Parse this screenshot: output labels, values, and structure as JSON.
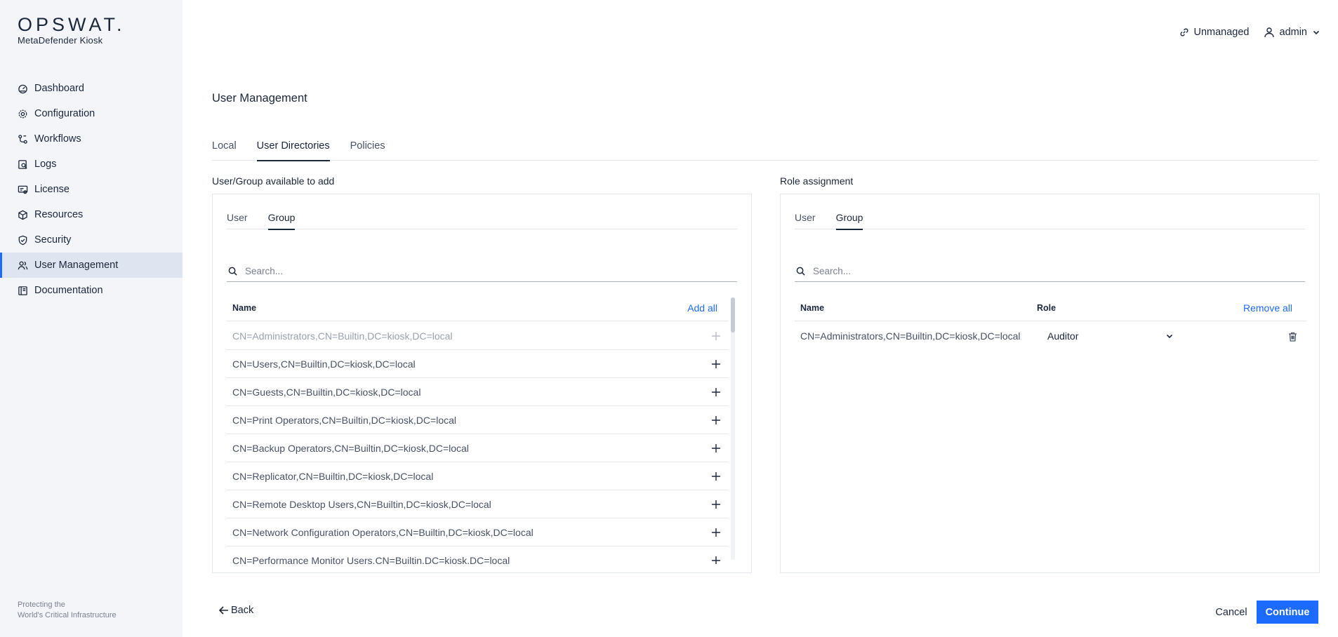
{
  "brand": {
    "logo": "OPSWAT.",
    "product": "MetaDefender Kiosk",
    "footer_line1": "Protecting the",
    "footer_line2": "World's Critical Infrastructure"
  },
  "sidebar": {
    "items": [
      {
        "label": "Dashboard",
        "icon": "dashboard-icon"
      },
      {
        "label": "Configuration",
        "icon": "gear-icon"
      },
      {
        "label": "Workflows",
        "icon": "workflow-icon"
      },
      {
        "label": "Logs",
        "icon": "logs-icon"
      },
      {
        "label": "License",
        "icon": "license-icon"
      },
      {
        "label": "Resources",
        "icon": "cube-icon"
      },
      {
        "label": "Security",
        "icon": "shield-icon"
      },
      {
        "label": "User Management",
        "icon": "users-icon",
        "active": true
      },
      {
        "label": "Documentation",
        "icon": "book-icon"
      }
    ]
  },
  "topbar": {
    "unmanaged": "Unmanaged",
    "user": "admin"
  },
  "page": {
    "title": "User Management",
    "tabs": [
      "Local",
      "User Directories",
      "Policies"
    ],
    "active_tab": "User Directories"
  },
  "available": {
    "label": "User/Group available to add",
    "tabs": [
      "User",
      "Group"
    ],
    "active_tab": "Group",
    "search_placeholder": "Search...",
    "col_name": "Name",
    "add_all": "Add all",
    "rows": [
      {
        "name": "CN=Administrators,CN=Builtin,DC=kiosk,DC=local",
        "disabled": true
      },
      {
        "name": "CN=Users,CN=Builtin,DC=kiosk,DC=local"
      },
      {
        "name": "CN=Guests,CN=Builtin,DC=kiosk,DC=local"
      },
      {
        "name": "CN=Print Operators,CN=Builtin,DC=kiosk,DC=local"
      },
      {
        "name": "CN=Backup Operators,CN=Builtin,DC=kiosk,DC=local"
      },
      {
        "name": "CN=Replicator,CN=Builtin,DC=kiosk,DC=local"
      },
      {
        "name": "CN=Remote Desktop Users,CN=Builtin,DC=kiosk,DC=local"
      },
      {
        "name": "CN=Network Configuration Operators,CN=Builtin,DC=kiosk,DC=local"
      },
      {
        "name": "CN=Performance Monitor Users,CN=Builtin,DC=kiosk,DC=local"
      }
    ]
  },
  "assignment": {
    "label": "Role assignment",
    "tabs": [
      "User",
      "Group"
    ],
    "active_tab": "Group",
    "search_placeholder": "Search...",
    "col_name": "Name",
    "col_role": "Role",
    "remove_all": "Remove all",
    "rows": [
      {
        "name": "CN=Administrators,CN=Builtin,DC=kiosk,DC=local",
        "role": "Auditor"
      }
    ]
  },
  "footer": {
    "back": "Back",
    "cancel": "Cancel",
    "continue": "Continue"
  },
  "colors": {
    "accent": "#1d6bfc",
    "sidebar_bg": "#f3f5f9",
    "active_nav_bg": "#dfe5f0",
    "text": "#1b273a"
  }
}
